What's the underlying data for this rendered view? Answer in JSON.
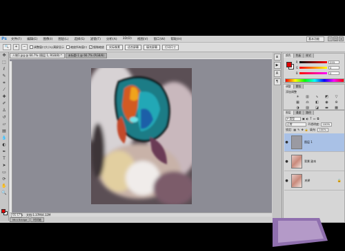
{
  "app": {
    "logo": "Ps"
  },
  "menu": [
    "文件(F)",
    "编辑(E)",
    "图像(I)",
    "图层(L)",
    "选择(S)",
    "滤镜(T)",
    "分析(A)",
    "3D(D)",
    "视图(V)",
    "窗口(W)",
    "帮助(H)"
  ],
  "workspace": "基本功能",
  "window_controls": [
    "–",
    "□",
    "×"
  ],
  "options": {
    "tool_icon": "🔍",
    "check1": "调整窗口大小以满屏显示",
    "check2": "缩放所有窗口",
    "check3": "细微缩放",
    "btn_actual": "实际像素",
    "btn_fit": "适合屏幕",
    "btn_fill": "填充屏幕",
    "btn_print": "打印尺寸"
  },
  "doc_tabs": [
    "人物1.jpg @ 66.7% (图层 1, RGB/8) *",
    "未标题-1 @ 66.7% (RGB/8)"
  ],
  "status": {
    "zoom": "66.67%",
    "doc": "文档:1.37M/4.12M"
  },
  "mini_tabs": [
    "Mini Bridge",
    "时间轴"
  ],
  "color_panel": {
    "tabs": [
      "颜色",
      "色板",
      "样式"
    ],
    "r_label": "R",
    "r_value": "255",
    "g_label": "G",
    "g_value": "0",
    "b_label": "B",
    "b_value": "0"
  },
  "adjust_panel": {
    "tabs": [
      "调整",
      "蒙版"
    ],
    "title": "添加调整"
  },
  "layers_panel": {
    "tabs": [
      "图层",
      "通道",
      "路径"
    ],
    "filter": "P 类型",
    "blend": "正常",
    "opacity_label": "不透明度:",
    "opacity": "100%",
    "lock_label": "锁定:",
    "fill_label": "填充:",
    "fill": "100%",
    "layers": [
      {
        "name": "图层 1",
        "selected": true
      },
      {
        "name": "背景 副本",
        "selected": false
      },
      {
        "name": "背景",
        "selected": false,
        "locked": true
      }
    ]
  },
  "colors": {
    "foreground": "#e00000",
    "background": "#ffffff",
    "canvas_bg": "#8c8c95",
    "selection": "#a9c1e6"
  }
}
